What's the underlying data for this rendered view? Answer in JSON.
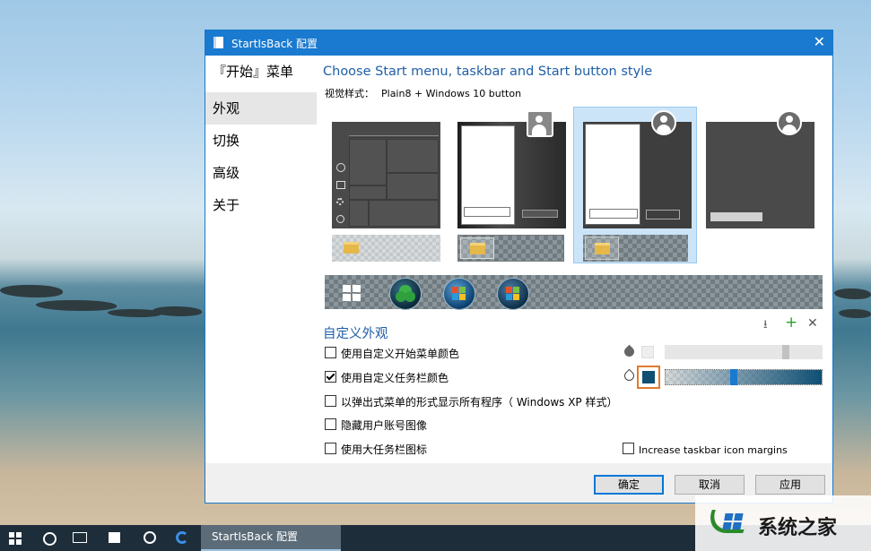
{
  "window": {
    "title": "StartIsBack 配置",
    "close_glyph": "✕"
  },
  "sidebar": {
    "items": [
      {
        "label": "『开始』菜单"
      },
      {
        "label": "外观"
      },
      {
        "label": "切换"
      },
      {
        "label": "高级"
      },
      {
        "label": "关于"
      }
    ],
    "active_index": 1
  },
  "main": {
    "heading": "Choose Start menu, taskbar and Start button style",
    "visual_style_label": "视觉样式：",
    "visual_style_value": "Plain8 + Windows 10 button",
    "selected_style_index": 2,
    "customize_title": "自定义外观",
    "options": [
      {
        "label": "使用自定义开始菜单颜色",
        "checked": false
      },
      {
        "label": "使用自定义任务栏颜色",
        "checked": true
      },
      {
        "label": "以弹出式菜单的形式显示所有程序（ Windows XP 样式）",
        "checked": false
      },
      {
        "label": "隐藏用户账号图像",
        "checked": false
      },
      {
        "label": "使用大任务栏图标",
        "checked": false
      }
    ],
    "margin_option": {
      "label": "Increase taskbar icon margins",
      "checked": false
    },
    "start_menu_slider": 0.78,
    "taskbar_slider": 0.43,
    "taskbar_color": "#0f4f73",
    "highlight_color": "#e07a2c"
  },
  "buttons": {
    "ok": "确定",
    "cancel": "取消",
    "apply": "应用"
  },
  "taskbar": {
    "app_label": "StartIsBack 配置"
  },
  "watermark": {
    "text": "系统之家"
  },
  "colors": {
    "accent": "#1a7ad0",
    "heading": "#1f5fa6"
  }
}
